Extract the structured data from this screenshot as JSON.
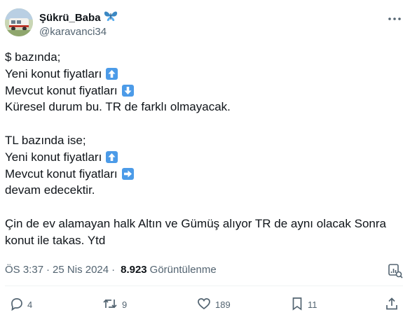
{
  "author": {
    "display_name": "Şükrü_Baba",
    "name_emoji": "butterfly",
    "handle": "@karavanci34"
  },
  "tweet": {
    "lines": [
      {
        "text": "$ bazında;",
        "icon": ""
      },
      {
        "text": "Yeni konut fiyatları",
        "icon": "up-arrow"
      },
      {
        "text": "Mevcut konut fiyatları",
        "icon": "down-arrow"
      },
      {
        "text": "Küresel durum bu. TR de farklı olmayacak.",
        "icon": ""
      },
      {
        "text": "",
        "icon": ""
      },
      {
        "text": "TL bazında ise;",
        "icon": ""
      },
      {
        "text": "Yeni konut fiyatları",
        "icon": "up-arrow"
      },
      {
        "text": "Mevcut konut fiyatları",
        "icon": "right-arrow"
      },
      {
        "text": "devam edecektir.",
        "icon": ""
      },
      {
        "text": "",
        "icon": ""
      },
      {
        "text": "Çin de ev alamayan halk Altın ve Gümüş alıyor TR de aynı olacak Sonra",
        "icon": ""
      },
      {
        "text": "konut ile takas. Ytd",
        "icon": ""
      }
    ]
  },
  "meta": {
    "time": "ÖS 3:37",
    "separator": "·",
    "date": "25 Nis 2024",
    "views_count": "8.923",
    "views_label": "Görüntülenme"
  },
  "actions": {
    "replies": "4",
    "reposts": "9",
    "likes": "189",
    "bookmarks": "11"
  },
  "colors": {
    "text": "#0f1419",
    "secondary": "#536471",
    "arrow_bg": "#4c9be8",
    "butterfly": "#3b88c3"
  }
}
